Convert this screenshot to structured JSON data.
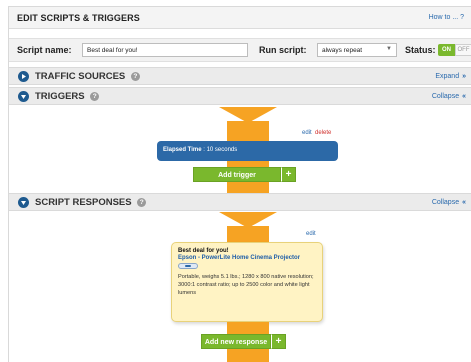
{
  "header": {
    "title": "EDIT SCRIPTS & TRIGGERS",
    "how_to": "How to ... ?"
  },
  "script_bar": {
    "name_label": "Script name:",
    "name_value": "Best deal for you!",
    "run_label": "Run script:",
    "run_value": "always repeat",
    "status_label": "Status:",
    "status_on": "ON",
    "status_off": "OFF"
  },
  "sections": {
    "traffic": {
      "title": "TRAFFIC SOURCES",
      "action": "Expand",
      "action_icon": "double-chevron-down-icon"
    },
    "triggers": {
      "title": "TRIGGERS",
      "action": "Collapse",
      "action_icon": "double-chevron-up-icon"
    },
    "responses": {
      "title": "SCRIPT RESPONSES",
      "action": "Collapse",
      "action_icon": "double-chevron-up-icon"
    }
  },
  "trigger": {
    "edit_label": "edit",
    "delete_label": "delete",
    "name": "Elapsed Time",
    "detail": " : 10 seconds",
    "add_label": "Add trigger",
    "plus": "+"
  },
  "response": {
    "edit_label": "edit",
    "title": "Best deal for you!",
    "product": "Epson - PowerLite Home Cinema Projector",
    "description": "Portable, weighs 5.1 lbs.; 1280 x 800 native resolution; 3000:1 contrast ratio; up to 2500 color and white light lumens",
    "add_label": "Add new response",
    "plus": "+"
  },
  "colors": {
    "accent_blue": "#2c69a7",
    "green": "#7ab82d",
    "orange": "#f6a323",
    "card_yellow": "#fff3c4"
  }
}
